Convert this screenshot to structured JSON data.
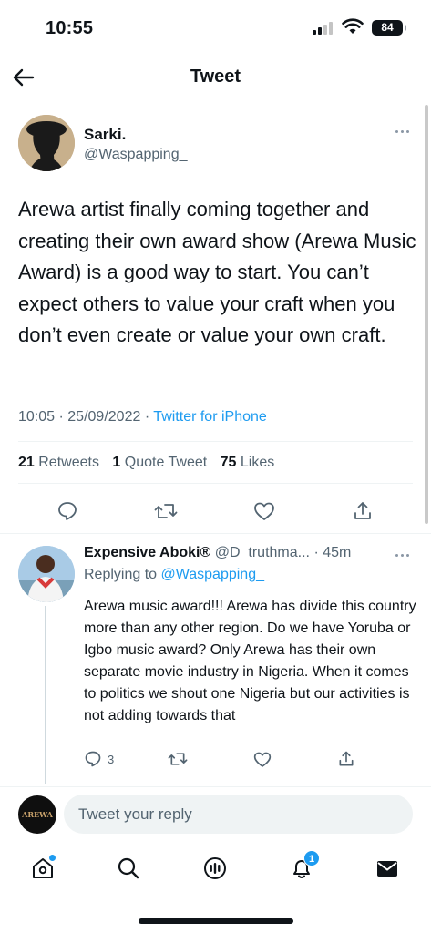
{
  "status_bar": {
    "time": "10:55",
    "battery": "84"
  },
  "header": {
    "title": "Tweet"
  },
  "tweet": {
    "author_name": "Sarki.",
    "author_handle": "@Waspapping_",
    "text": "Arewa artist finally coming together and creating their own award show (Arewa Music Award) is a good way to start. You can’t expect others to value your craft when you don’t even create or value your own craft.",
    "time": "10:05",
    "date": "25/09/2022",
    "separator": "·",
    "source": "Twitter for iPhone",
    "stats": {
      "retweets_count": "21",
      "retweets_label": "Retweets",
      "quotes_count": "1",
      "quotes_label": "Quote Tweet",
      "likes_count": "75",
      "likes_label": "Likes"
    }
  },
  "reply": {
    "author_name": "Expensive Aboki®",
    "author_handle": "@D_truthma...",
    "time": "· 45m",
    "replying_label": "Replying to",
    "replying_to": "@Waspapping_",
    "text": "Arewa music award!!! Arewa has divide this country more than any other region. Do we have Yoruba or Igbo music award? Only Arewa has their own separate movie industry in Nigeria. When it comes to politics we shout one Nigeria but our activities is not adding towards that",
    "reply_count": "3"
  },
  "composer": {
    "placeholder": "Tweet your reply",
    "avatar_text": "AREWA"
  },
  "tabs": {
    "notifications_badge": "1"
  },
  "colors": {
    "accent": "#1d9bf0",
    "text": "#0f1419",
    "secondary": "#536471"
  },
  "icons": [
    "back-arrow-icon",
    "more-icon",
    "reply-icon",
    "retweet-icon",
    "like-icon",
    "share-icon",
    "home-icon",
    "search-icon",
    "spaces-icon",
    "notifications-icon",
    "messages-icon"
  ]
}
